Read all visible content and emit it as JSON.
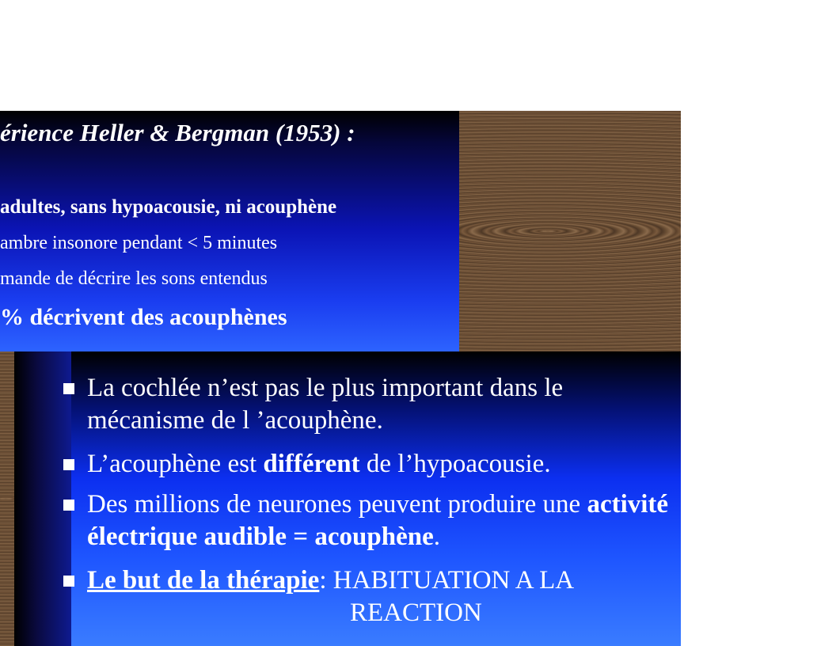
{
  "top_panel": {
    "heading": "érience Heller & Bergman (1953) :",
    "lines": [
      "adultes, sans hypoacousie, ni acouphène",
      "ambre insonore pendant  < 5 minutes",
      "mande de décrire les sons entendus",
      "% décrivent des acouphènes"
    ]
  },
  "bullets": {
    "b1": "La cochlée  n’est pas le plus important dans le mécanisme de l ’acouphène.",
    "b2_pre": "L’acouphène est ",
    "b2_bold": "différent",
    "b2_post": " de l’hypoacousie.",
    "b3_pre": "Des millions de neurones peuvent produire une ",
    "b3_bold": "activité électrique audible = acouphène",
    "b3_post": ".",
    "b4_label": "Le but de la thérapie",
    "b4_text": ": HABITUATION A LA",
    "b4_cont": "REACTION"
  }
}
